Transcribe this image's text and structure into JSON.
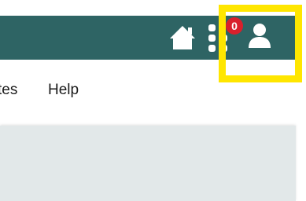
{
  "topbar": {
    "background": "#2e6464",
    "home_icon": "home-icon",
    "apps_icon": "apps-grid-icon",
    "notification_count": "0",
    "notification_color": "#d9202c",
    "user_icon": "user-icon",
    "highlight_color": "#ffe600"
  },
  "nav": {
    "items": [
      {
        "label": "tes"
      },
      {
        "label": "Help"
      }
    ]
  },
  "content": {
    "background": "#e2e8e9"
  }
}
